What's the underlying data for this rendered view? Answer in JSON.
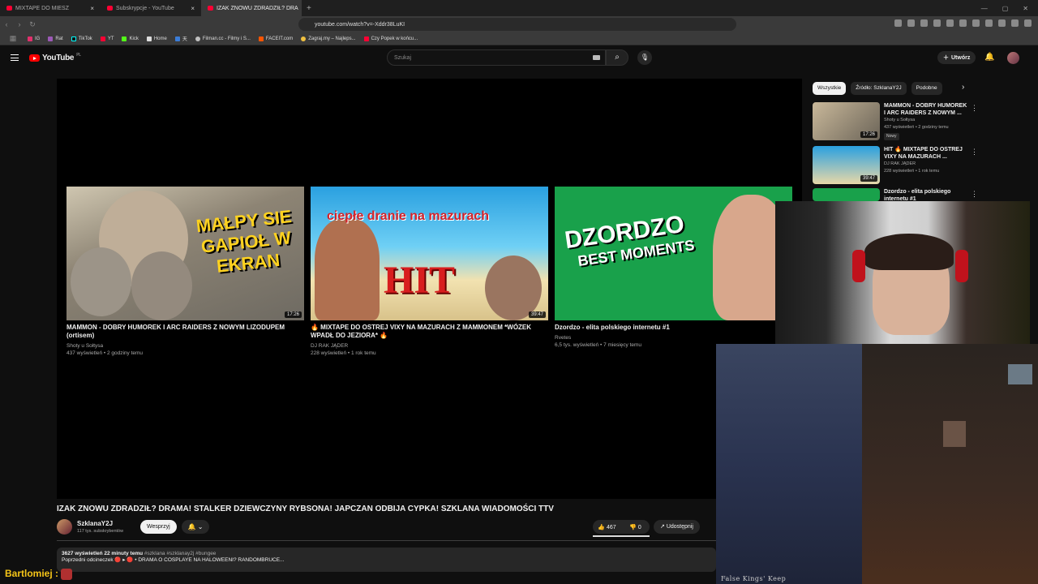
{
  "browser": {
    "tabs": [
      {
        "label": "MIXTAPE DO MIESZ",
        "active": false
      },
      {
        "label": "Subskrypcje - YouTube",
        "active": false
      },
      {
        "label": "IZAK ZNOWU ZDRADZIŁ? DRA",
        "active": true
      }
    ],
    "url": "youtube.com/watch?v=-Xddr38LuKI",
    "bookmarks": [
      "IG",
      "Rat",
      "TikTok",
      "YT",
      "Kick",
      "Home",
      "天",
      "Filman.cc - Filmy i S...",
      "FACEIT.com",
      "Zagraj.my – Najleps...",
      "Czy Popek w końcu..."
    ]
  },
  "youtube": {
    "logo_text": "YouTube",
    "region": "PL",
    "search_placeholder": "Szukaj",
    "create_label": "Utwórz"
  },
  "endscreen": [
    {
      "title": "MAMMON - DOBRY HUMOREK I ARC RAIDERS Z NOWYM LIZODUPEM (ortisem)",
      "channel": "Shoty u Sołtysa",
      "meta": "437 wyświetleń • 2 godziny temu",
      "duration": "17:26",
      "thumb_text": "MAŁPY SIE GAPIOŁ W EKRAN"
    },
    {
      "title": "🔥 MIXTAPE DO OSTREJ VIXY NA MAZURACH Z MAMMONEM *WÓZEK WPADŁ DO JEZIORA* 🔥",
      "channel": "DJ RAK JĄDER",
      "meta": "228 wyświetleń • 1 rok temu",
      "duration": "39:47",
      "thumb_text": "ciepłe dranie na mazurach",
      "thumb_hit": "HIT"
    },
    {
      "title": "Dzordzo - elita polskiego internetu #1",
      "channel": "Rvetes",
      "meta": "6,5 tys. wyświetleń • 7 miesięcy temu",
      "duration": "",
      "thumb_text": "DZORDZO",
      "thumb_text2": "BEST MOMENTS"
    }
  ],
  "video": {
    "title": "IZAK ZNOWU ZDRADZIŁ? DRAMA! STALKER DZIEWCZYNY RYBSONA! JAPCZAN ODBIJA CYPKA! SZKLANA WIADOMOŚCI TTV",
    "channel": "SzklanaY2J",
    "subscribers": "117 tys. subskrybentów",
    "support_label": "Wesprzyj",
    "likes": "467",
    "dislikes": "0",
    "share_label": "Udostępnij",
    "views_time": "3627 wyświetleń  22 minuty temu",
    "hashtags": "#szklana #szklanay2j #bungee",
    "prev_episode": "Poprzedni odcineczek 🔴 ▸ 🔴 • DRAMA O COSPLAYE NA HALOWEENI? RANDOMBRUCE..."
  },
  "sidebar": {
    "chips": [
      "Wszystkie",
      "Źródło: SzklanaY2J",
      "Podobne"
    ],
    "items": [
      {
        "title": "MAMMON - DOBRY HUMOREK I ARC RAIDERS Z NOWYM ...",
        "channel": "Shoty u Sołtysa",
        "meta": "437 wyświetleń • 2 godziny temu",
        "badge": "Nowy",
        "duration": "17:26"
      },
      {
        "title": "HIT 🔥 MIXTAPE DO OSTREJ VIXY NA MAZURACH ...",
        "channel": "DJ RAK JĄDER",
        "meta": "228 wyświetleń • 1 rok temu",
        "badge": "",
        "duration": "39:47"
      },
      {
        "title": "Dzordzo - elita polskiego internetu #1",
        "channel": "",
        "meta": "",
        "badge": "",
        "duration": ""
      }
    ]
  },
  "overlay": {
    "game_title": "False Kings' Keep",
    "chat_user": "Bartlomiej :"
  }
}
